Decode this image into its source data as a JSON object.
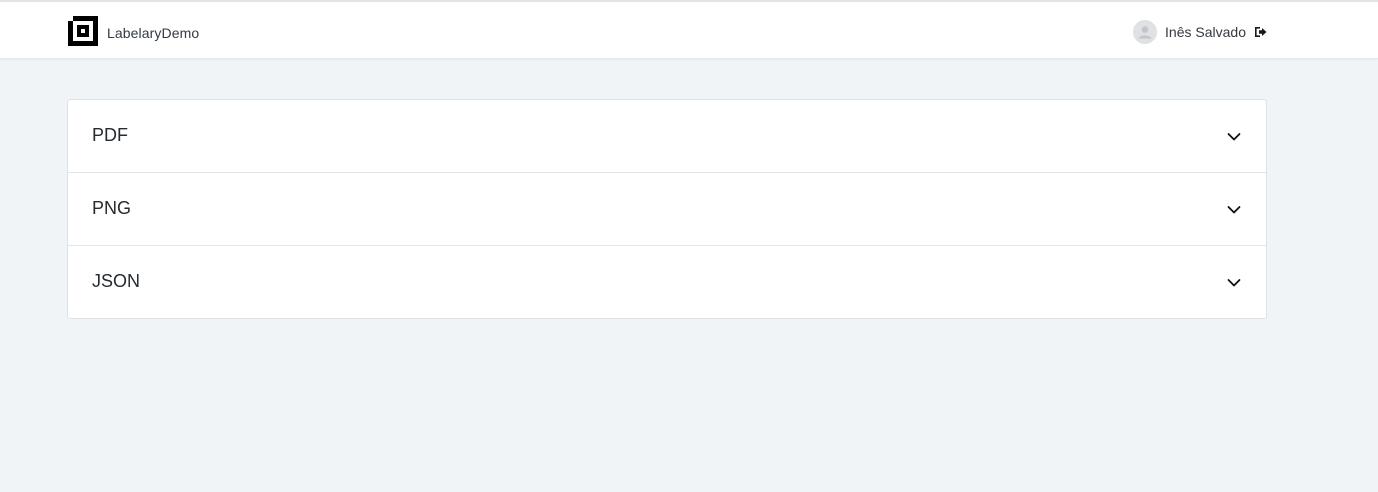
{
  "header": {
    "brand_name": "LabelaryDemo",
    "user_name": "Inês Salvado"
  },
  "accordion": {
    "items": [
      {
        "label": "PDF"
      },
      {
        "label": "PNG"
      },
      {
        "label": "JSON"
      }
    ]
  }
}
